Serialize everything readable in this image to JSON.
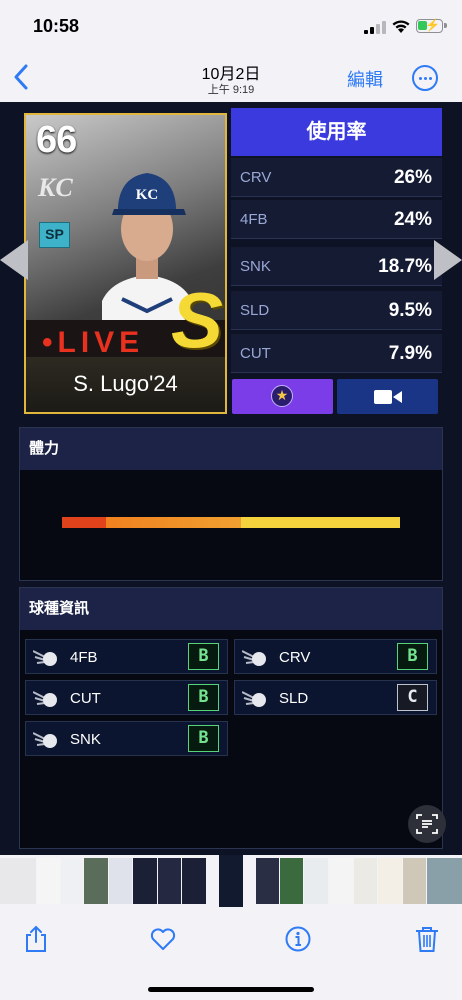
{
  "status_bar": {
    "time": "10:58"
  },
  "nav": {
    "date": "10月2日",
    "time": "上午 9:19",
    "edit_label": "編輯"
  },
  "card": {
    "rating": "66",
    "team": "KC",
    "position": "SP",
    "live_label": "•LIVE",
    "series_letter": "S",
    "player_name": "S. Lugo'24"
  },
  "usage": {
    "title": "使用率",
    "rows": [
      {
        "pitch": "CRV",
        "value": "26%"
      },
      {
        "pitch": "4FB",
        "value": "24%"
      },
      {
        "pitch": "SNK",
        "value": "18.7%"
      },
      {
        "pitch": "SLD",
        "value": "9.5%"
      },
      {
        "pitch": "CUT",
        "value": "7.9%"
      }
    ]
  },
  "stamina": {
    "title": "體力"
  },
  "pitch_info": {
    "title": "球種資訊",
    "pitches": [
      {
        "name": "4FB",
        "grade": "B"
      },
      {
        "name": "CRV",
        "grade": "B"
      },
      {
        "name": "CUT",
        "grade": "B"
      },
      {
        "name": "SLD",
        "grade": "C"
      },
      {
        "name": "SNK",
        "grade": "B"
      }
    ]
  },
  "colors": {
    "accent": "#2f7bf6",
    "usage_header": "#3b3adf",
    "card_border": "#e0b73a",
    "live_red": "#e8321f",
    "grade_green": "#74e28e"
  }
}
